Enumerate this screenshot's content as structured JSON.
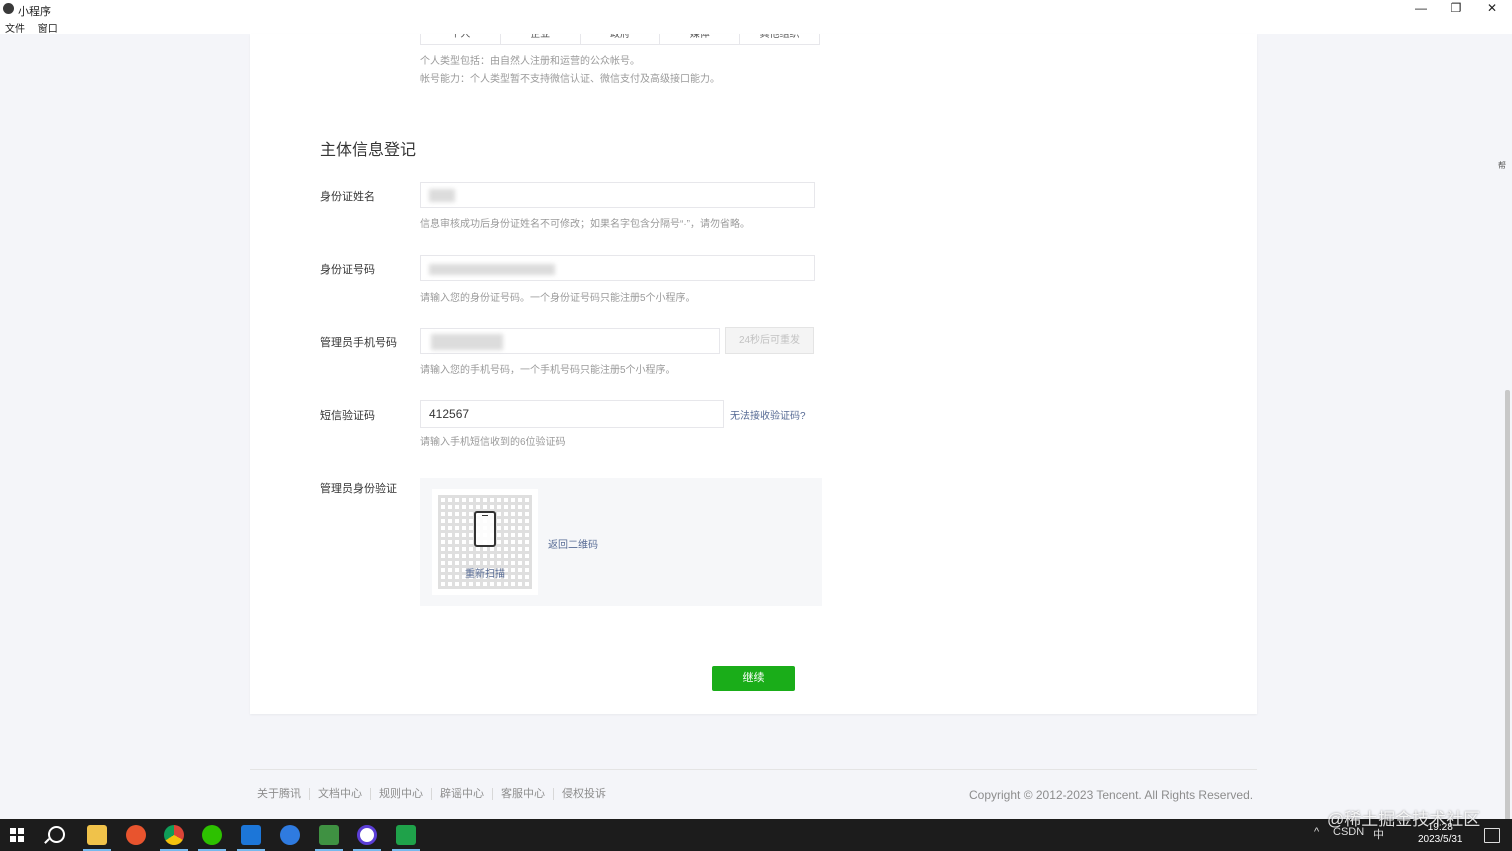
{
  "window": {
    "title": "小程序",
    "menu": [
      "文件",
      "窗口"
    ],
    "min_glyph": "—",
    "max_glyph": "❐",
    "close_glyph": "✕"
  },
  "tabs": [
    "个人",
    "企业",
    "政府",
    "媒体",
    "其他组织"
  ],
  "notes": {
    "type_desc": "个人类型包括：由自然人注册和运营的公众帐号。",
    "ability_desc": "帐号能力：个人类型暂不支持微信认证、微信支付及高级接口能力。"
  },
  "section_title": "主体信息登记",
  "form": {
    "id_name": {
      "label": "身份证姓名",
      "hint": "信息审核成功后身份证姓名不可修改；如果名字包含分隔号“·”，请勿省略。"
    },
    "id_number": {
      "label": "身份证号码",
      "hint": "请输入您的身份证号码。一个身份证号码只能注册5个小程序。"
    },
    "phone": {
      "label": "管理员手机号码",
      "resend_btn": "24秒后可重发",
      "hint": "请输入您的手机号码，一个手机号码只能注册5个小程序。"
    },
    "sms": {
      "label": "短信验证码",
      "value": "412567",
      "cant_receive": "无法接收验证码?",
      "hint": "请输入手机短信收到的6位验证码"
    },
    "admin_verify": {
      "label": "管理员身份验证",
      "rescan": "重新扫描",
      "back_qr": "返回二维码"
    }
  },
  "continue_btn": "继续",
  "footer": {
    "links": [
      "关于腾讯",
      "文档中心",
      "规则中心",
      "辟谣中心",
      "客服中心",
      "侵权投诉"
    ],
    "copyright": "Copyright © 2012-2023 Tencent. All Rights Reserved."
  },
  "side_mark": "帮",
  "taskbar": {
    "tray": [
      "^",
      "CSDN",
      "中"
    ],
    "time": "19:28",
    "date": "2023/5/31"
  },
  "watermark": "@稀土掘金技术社区",
  "colors": {
    "primary_green": "#1aad19",
    "link_blue": "#576b95"
  }
}
